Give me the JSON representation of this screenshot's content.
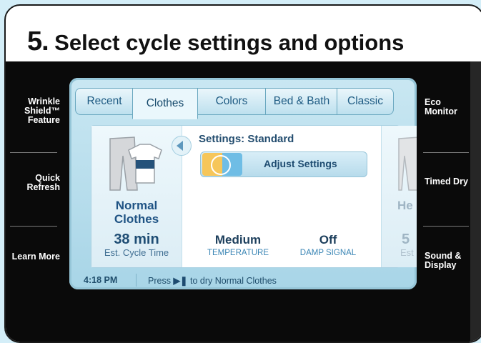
{
  "heading": {
    "number": "5.",
    "text": "Select cycle settings and options"
  },
  "left_buttons": [
    {
      "label": "Wrinkle Shield™ Feature"
    },
    {
      "label": "Quick Refresh"
    },
    {
      "label": "Learn More"
    }
  ],
  "right_buttons": [
    {
      "label": "Eco Monitor"
    },
    {
      "label": "Timed Dry"
    },
    {
      "label": "Sound & Display"
    }
  ],
  "tabs": [
    {
      "label": "Recent"
    },
    {
      "label": "Clothes",
      "active": true
    },
    {
      "label": "Colors"
    },
    {
      "label": "Bed & Bath"
    },
    {
      "label": "Classic"
    }
  ],
  "cycle": {
    "name_line1": "Normal",
    "name_line2": "Clothes",
    "time": "38 min",
    "time_label": "Est. Cycle Time"
  },
  "settings": {
    "title": "Settings: Standard",
    "adjust_label": "Adjust Settings",
    "temperature_value": "Medium",
    "temperature_label": "TEMPERATURE",
    "damp_value": "Off",
    "damp_label": "DAMP SIGNAL"
  },
  "next_cycle_peek": {
    "name": "He",
    "time": "5",
    "time_label": "Est"
  },
  "status": {
    "time": "4:18 PM",
    "message_prefix": "Press",
    "message_suffix": "to dry Normal Clothes"
  },
  "colors": {
    "accent": "#1d5a82",
    "screen": "#b8def0",
    "panel": "#0a0a0a"
  }
}
